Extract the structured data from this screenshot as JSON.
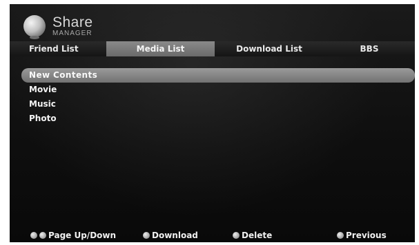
{
  "app": {
    "logo_title": "Share",
    "logo_subtitle": "MANAGER"
  },
  "tabs": [
    {
      "label": "Friend List",
      "selected": false
    },
    {
      "label": "Media List",
      "selected": true
    },
    {
      "label": "Download List",
      "selected": false
    },
    {
      "label": "BBS",
      "selected": false
    }
  ],
  "list": {
    "items": [
      {
        "label": "New Contents",
        "selected": true
      },
      {
        "label": "Movie",
        "selected": false
      },
      {
        "label": "Music",
        "selected": false
      },
      {
        "label": "Photo",
        "selected": false
      }
    ]
  },
  "footer": {
    "page_label": "Page Up/Down",
    "download_label": "Download",
    "delete_label": "Delete",
    "previous_label": "Previous"
  },
  "icons": {
    "logo": "globe-icon",
    "legend_button": "button-dot-icon"
  },
  "colors": {
    "background": "#111111",
    "highlight": "#8a8a8a",
    "text": "#f2f2f2"
  }
}
